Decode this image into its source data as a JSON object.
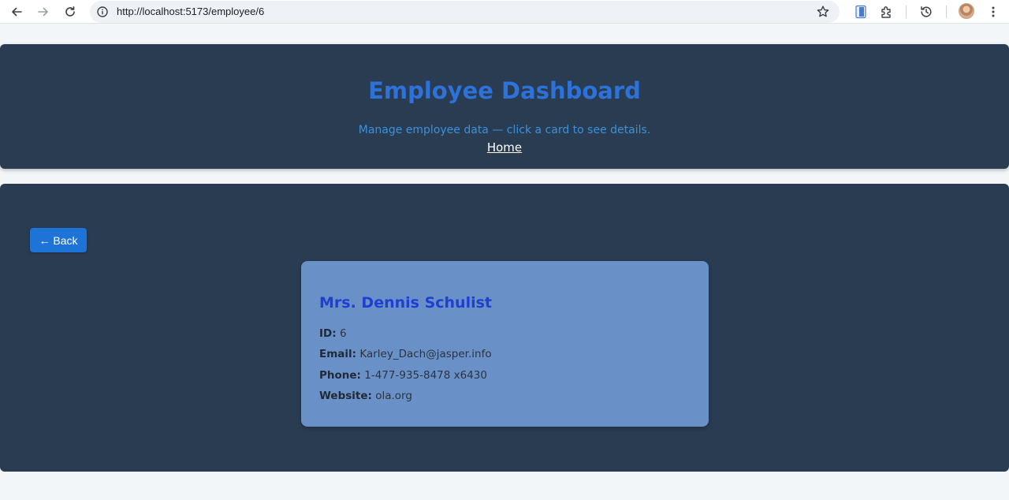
{
  "browser": {
    "url": "http://localhost:5173/employee/6"
  },
  "header": {
    "title": "Employee Dashboard",
    "subtitle": "Manage employee data — click a card to see details.",
    "home_link": "Home"
  },
  "main": {
    "back_button": "← Back",
    "employee": {
      "name": "Mrs. Dennis Schulist",
      "fields": [
        {
          "label": "ID:",
          "value": "6"
        },
        {
          "label": "Email:",
          "value": "Karley_Dach@jasper.info"
        },
        {
          "label": "Phone:",
          "value": "1-477-935-8478 x6430"
        },
        {
          "label": "Website:",
          "value": "ola.org"
        }
      ]
    }
  },
  "colors": {
    "panel": "#2a3c52",
    "title": "#2d72d9",
    "subtitle": "#3b92dc",
    "card": "#6991c7",
    "card_name": "#1f3fd1",
    "button": "#1e74d6"
  }
}
